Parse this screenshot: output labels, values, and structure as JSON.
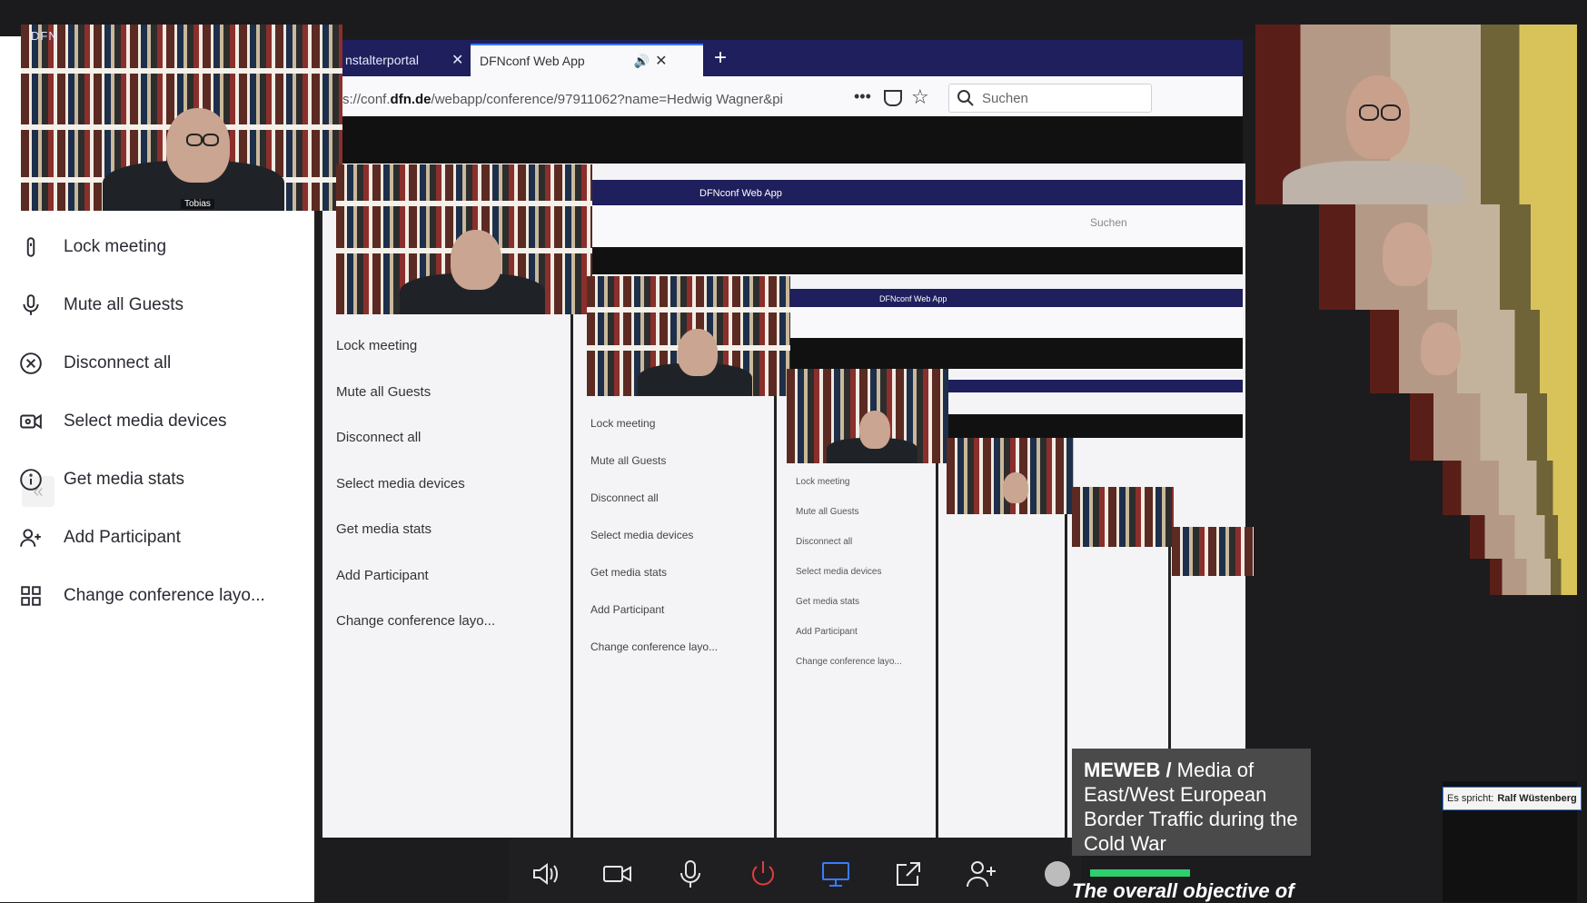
{
  "app": {
    "brand": "DFN"
  },
  "sidebar": {
    "items": [
      {
        "label": "Lock meeting",
        "icon": "lock-icon"
      },
      {
        "label": "Mute all Guests",
        "icon": "microphone-icon"
      },
      {
        "label": "Disconnect all",
        "icon": "close-circle-icon"
      },
      {
        "label": "Select media devices",
        "icon": "camera-settings-icon"
      },
      {
        "label": "Get media stats",
        "icon": "info-icon"
      },
      {
        "label": "Add Participant",
        "icon": "add-user-icon"
      },
      {
        "label": "Change conference layo...",
        "icon": "grid-icon"
      }
    ]
  },
  "browser": {
    "tabs": [
      {
        "label": "nstalterportal"
      },
      {
        "label": "DFNconf Web App"
      }
    ],
    "url_prefix": "s://conf.",
    "url_domain": "dfn.de",
    "url_suffix": "/webapp/conference/97911062?name=Hedwig Wagner&pi",
    "search_placeholder": "Suchen"
  },
  "cams": {
    "tobias_label": "Tobias"
  },
  "info_card": {
    "title": "MEWEB /",
    "text": " Media of East/West European Border Traffic during the Cold War",
    "subtitle": "The overall objective of"
  },
  "speaker": {
    "prefix": "Es spricht:",
    "name": "Ralf Wüstenberg"
  },
  "colors": {
    "tabbar": "#1e1f5c",
    "accent": "#3a76ff",
    "hangup": "#e63b3b",
    "screen_share": "#3b7bff",
    "progress": "#2ecf6e"
  }
}
